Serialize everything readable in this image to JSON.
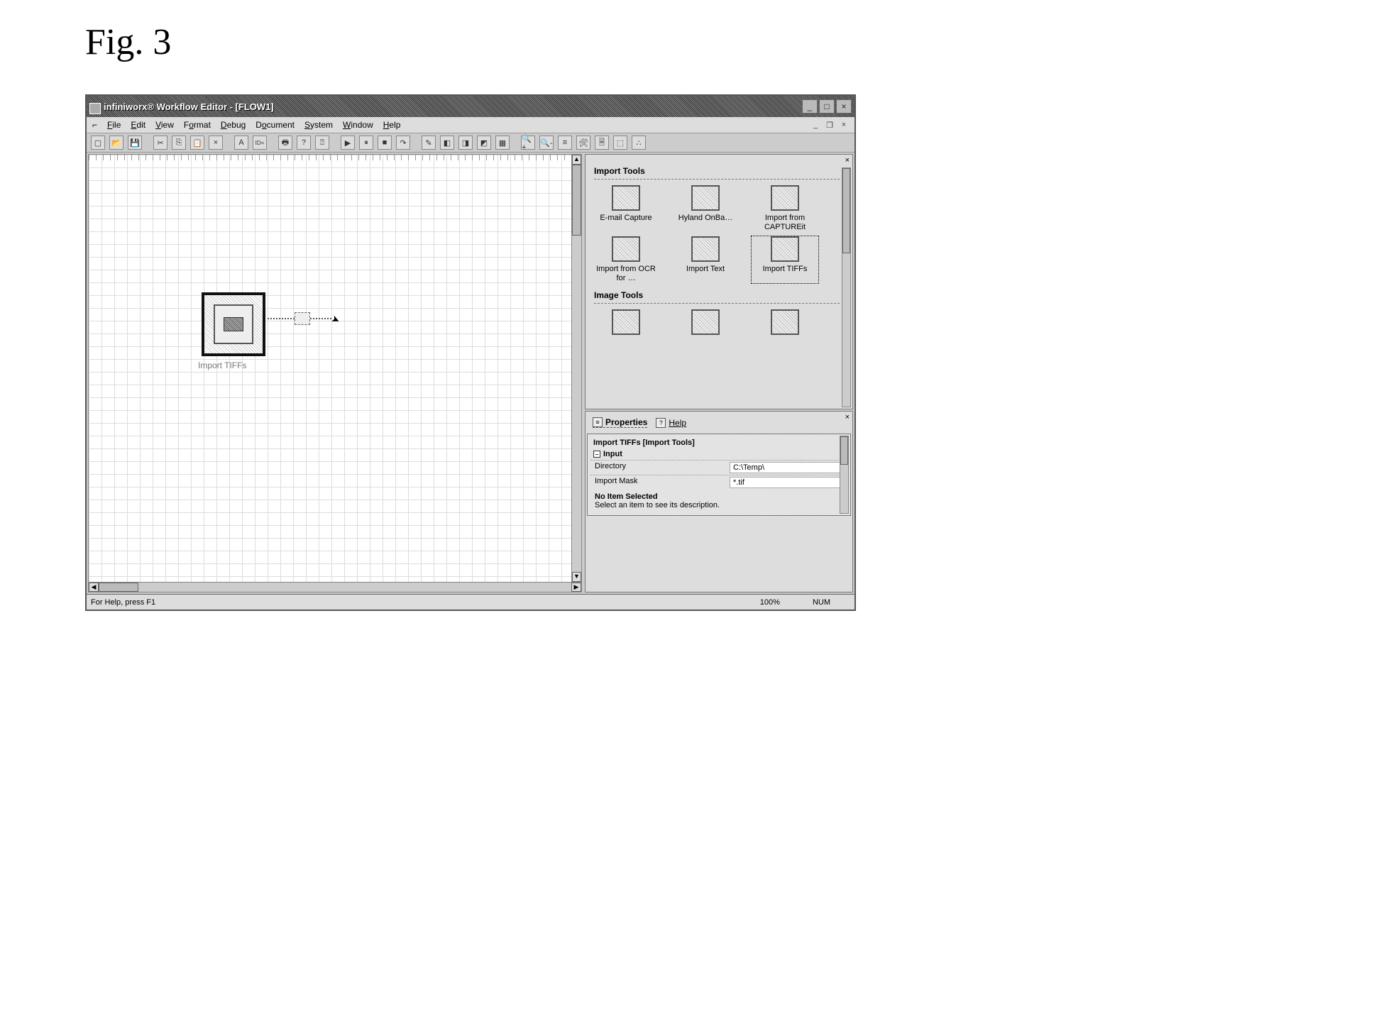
{
  "figure_label": "Fig. 3",
  "title": "infiniworx® Workflow Editor - [FLOW1]",
  "window_controls": {
    "min": "_",
    "max": "□",
    "close": "×"
  },
  "mdi_controls": {
    "min": "_",
    "restore": "❐",
    "close": "×"
  },
  "menu": [
    "File",
    "Edit",
    "View",
    "Format",
    "Debug",
    "Document",
    "System",
    "Window",
    "Help"
  ],
  "menu_sys": "⌐",
  "canvas": {
    "node_label": "Import TIFFs"
  },
  "toolbox": {
    "group1_title": "Import Tools",
    "group2_title": "Image Tools",
    "items1": [
      "E-mail Capture",
      "Hyland OnBa…",
      "Import from CAPTUREit",
      "Import from OCR for …",
      "Import Text",
      "Import TIFFs"
    ],
    "selected_index": 5
  },
  "props": {
    "tab_properties": "Properties",
    "tab_help": "Help",
    "header": "Import TIFFs [Import Tools]",
    "group": "Input",
    "rows": [
      {
        "k": "Directory",
        "v": "C:\\Temp\\"
      },
      {
        "k": "Import Mask",
        "v": "*.tif"
      }
    ],
    "no_item": "No Item Selected",
    "no_item_desc": "Select an item to see its description."
  },
  "status": {
    "help": "For Help, press F1",
    "zoom": "100%",
    "num": "NUM"
  }
}
